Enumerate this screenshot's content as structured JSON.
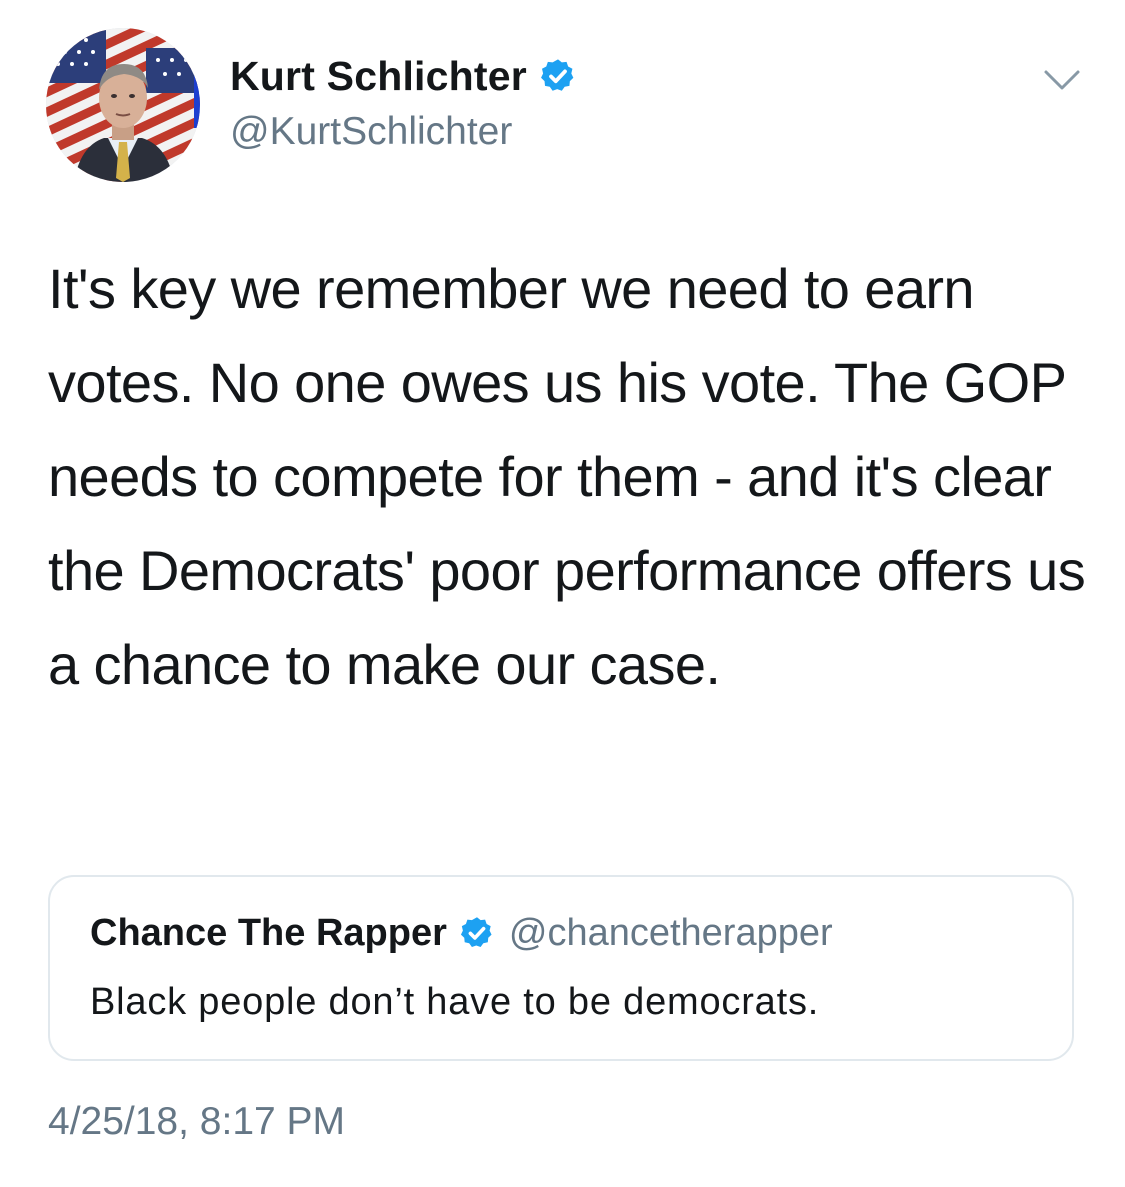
{
  "author": {
    "display_name": "Kurt Schlichter",
    "handle": "@KurtSchlichter",
    "verified": true
  },
  "tweet": {
    "text": "It's key we remember we need to earn votes. No one owes us his vote. The GOP needs to compete for them - and it's clear the Democrats' poor performance offers us a chance to make our case."
  },
  "quoted_tweet": {
    "display_name": "Chance The Rapper",
    "handle": "@chancetherapper",
    "verified": true,
    "text": "Black people don’t have to be democrats."
  },
  "timestamp": "4/25/18, 8:17 PM",
  "colors": {
    "verified_blue": "#1da1f2",
    "secondary_text": "#657786",
    "border": "#e1e8ed"
  },
  "icons": {
    "verified": "verified-badge-icon",
    "menu": "chevron-down-icon"
  }
}
